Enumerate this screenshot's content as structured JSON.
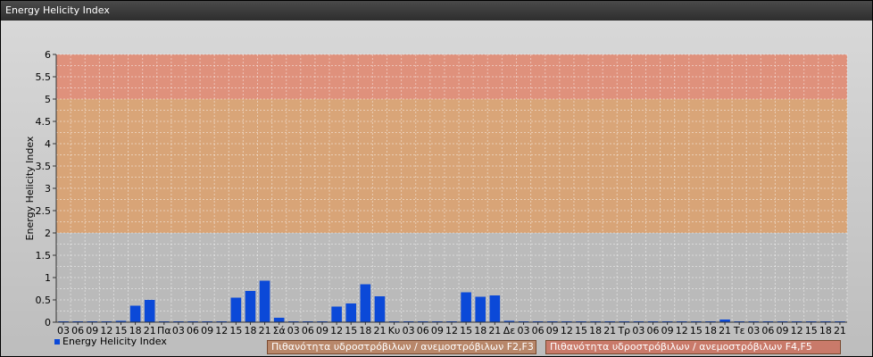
{
  "window": {
    "title": "Energy Helicity Index"
  },
  "chart_data": {
    "type": "bar",
    "title": "",
    "ylabel": "Energy Helicity Index",
    "xlabel": "",
    "ylim": [
      0,
      6
    ],
    "yticks": [
      "0",
      "0.5",
      "1",
      "1.5",
      "2",
      "2.5",
      "3",
      "3.5",
      "4",
      "4.5",
      "5",
      "5.5",
      "6"
    ],
    "categories": [
      "03",
      "06",
      "09",
      "12",
      "15",
      "18",
      "21",
      "Πα",
      "03",
      "06",
      "09",
      "12",
      "15",
      "18",
      "21",
      "Σά",
      "03",
      "06",
      "09",
      "12",
      "15",
      "18",
      "21",
      "Κυ",
      "03",
      "06",
      "09",
      "12",
      "15",
      "18",
      "21",
      "Δε",
      "03",
      "06",
      "09",
      "12",
      "15",
      "18",
      "21",
      "Τρ",
      "03",
      "06",
      "09",
      "12",
      "15",
      "18",
      "21",
      "Τε",
      "03",
      "06",
      "09",
      "12",
      "15",
      "18",
      "21"
    ],
    "series": [
      {
        "name": "Energy Helicity Index",
        "color": "#0b49d8",
        "values": [
          0.02,
          0.02,
          0.02,
          0.02,
          0.03,
          0.37,
          0.5,
          0.02,
          0.02,
          0.02,
          0.02,
          0.02,
          0.55,
          0.7,
          0.93,
          0.1,
          0.02,
          0.02,
          0.02,
          0.35,
          0.42,
          0.85,
          0.58,
          0.02,
          0.02,
          0.02,
          0.02,
          0.02,
          0.67,
          0.57,
          0.6,
          0.03,
          0.02,
          0.02,
          0.02,
          0.02,
          0.02,
          0.02,
          0.02,
          0.02,
          0.02,
          0.02,
          0.02,
          0.02,
          0.02,
          0.02,
          0.06,
          0.02,
          0.02,
          0.02,
          0.02,
          0.02,
          0.02,
          0.02,
          0.02
        ]
      }
    ],
    "bands": [
      {
        "from": 0,
        "to": 2,
        "color": "#b9b9b9"
      },
      {
        "from": 2,
        "to": 5,
        "color": "#d9a06e",
        "label": "Πιθανότητα υδροστρόβιλων / ανεμοστρόβιλων F2,F3"
      },
      {
        "from": 5,
        "to": 6,
        "color": "#e08a72",
        "label": "Πιθανότητα υδροστρόβιλων / ανεμοστρόβιλων F4,F5"
      }
    ],
    "grid": true,
    "legend": "bottom-left"
  }
}
